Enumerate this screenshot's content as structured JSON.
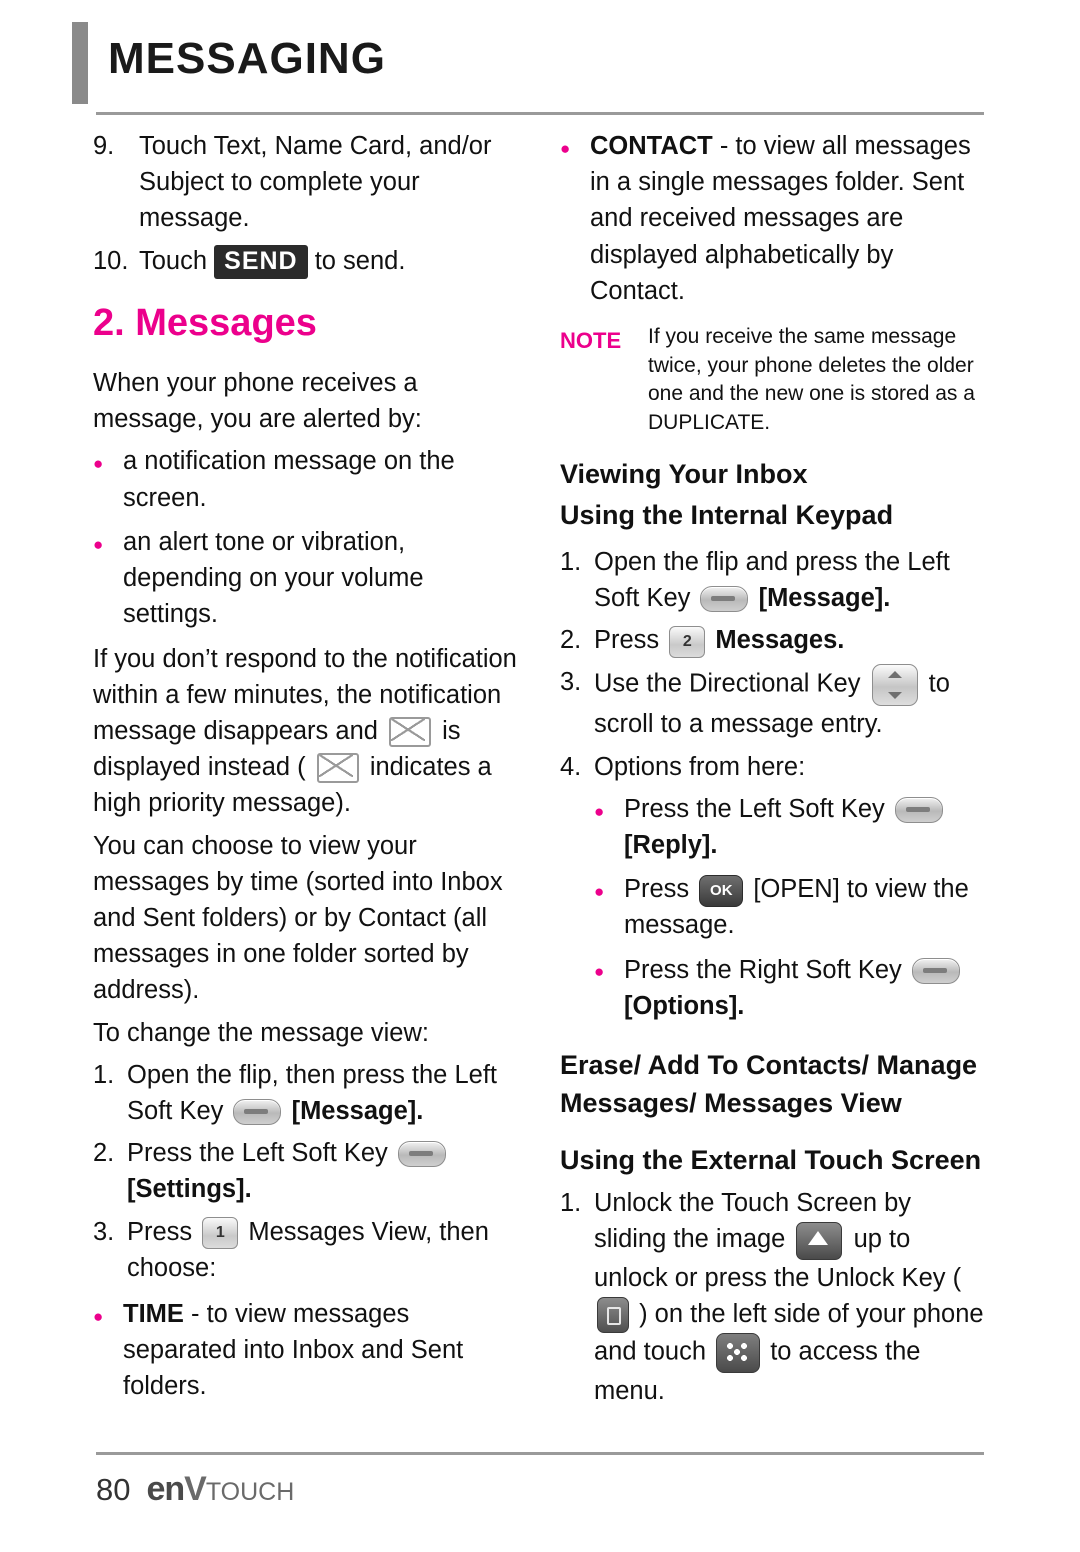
{
  "header": {
    "title": "MESSAGING"
  },
  "left_column": {
    "step9": {
      "num": "9.",
      "text": "Touch Text, Name Card, and/or Subject to complete your message."
    },
    "step10": {
      "num": "10.",
      "pre": "Touch",
      "key": "SEND",
      "post": "to send."
    },
    "section_title": "2. Messages",
    "intro": "When your phone receives a message, you are alerted by:",
    "alert_bullets": [
      "a notification message on the screen.",
      "an alert tone or vibration, depending on your volume settings."
    ],
    "no_respond_p1": "If you don’t respond to the notification within a few minutes, the notification message disappears and",
    "no_respond_p2": "is displayed instead (",
    "no_respond_p3": "indicates a high priority message).",
    "choose_view": "You can choose to view your messages by time (sorted into Inbox and Sent folders) or by Contact (all messages in one folder sorted by address).",
    "change_view_lead": "To change the message view:",
    "cv_step1_num": "1.",
    "cv_step1_a": "Open the flip, then press the Left Soft Key",
    "cv_step1_b": "[Message].",
    "cv_step2_num": "2.",
    "cv_step2_a": "Press the Left Soft Key",
    "cv_step2_b": "[Settings].",
    "cv_step3_num": "3.",
    "cv_step3_a": "Press",
    "cv_step3_key": "1",
    "cv_step3_b": "Messages View, then choose:",
    "time_bullet_label": "TIME",
    "time_bullet_text": "- to view messages separated into Inbox and Sent folders."
  },
  "right_column": {
    "contact_bullet_label": "CONTACT",
    "contact_bullet_text": "- to view all messages in a single messages folder. Sent and received messages are displayed alphabetically by Contact.",
    "note_label": "NOTE",
    "note_text": "If you receive the same message twice, your phone deletes the older one and the new one is stored as a DUPLICATE.",
    "heading_viewing": "Viewing Your Inbox",
    "heading_internal": "Using the Internal Keypad",
    "ik_step1_num": "1.",
    "ik_step1_a": "Open the flip and press the Left Soft Key",
    "ik_step1_b": "[Message].",
    "ik_step2_num": "2.",
    "ik_step2_a": "Press",
    "ik_step2_key": "2",
    "ik_step2_b": "Messages.",
    "ik_step3_num": "3.",
    "ik_step3_a": "Use the Directional Key",
    "ik_step3_b": "to scroll to a message entry.",
    "ik_step4_num": "4.",
    "ik_step4_a": "Options from here:",
    "opt1_a": "Press the Left Soft Key",
    "opt1_b": "[Reply].",
    "opt2_a": "Press",
    "opt2_key": "OK",
    "opt2_b": "[OPEN] to view the message.",
    "opt3_a": "Press the Right Soft Key",
    "opt3_b": "[Options].",
    "heading_erase": "Erase/ Add To Contacts/ Manage Messages/ Messages View",
    "heading_external": "Using the External Touch Screen",
    "ts_step1_num": "1.",
    "ts_step1_a": "Unlock the Touch Screen by sliding the image",
    "ts_step1_b": "up to unlock or press the Unlock Key (",
    "ts_step1_c": ") on the left side of your phone and touch",
    "ts_step1_d": "to access the menu."
  },
  "footer": {
    "page_number": "80",
    "brand_en": "en",
    "brand_v": "V",
    "brand_touch": "TOUCH"
  },
  "colors": {
    "accent_pink": "#ec008c",
    "rule_gray": "#9a9a9a",
    "title_gray": "#8a8a8a"
  },
  "icons": {
    "soft_key": "soft-key-icon",
    "num_key_1": "numeric-key-1-icon",
    "num_key_2": "numeric-key-2-icon",
    "directional_key": "directional-key-icon",
    "ok_key": "ok-key-icon",
    "envelope": "envelope-icon",
    "envelope_priority": "envelope-priority-icon",
    "arrow_up": "arrow-up-unlock-icon",
    "unlock_key": "unlock-key-icon",
    "menu_grid": "menu-grid-icon"
  }
}
